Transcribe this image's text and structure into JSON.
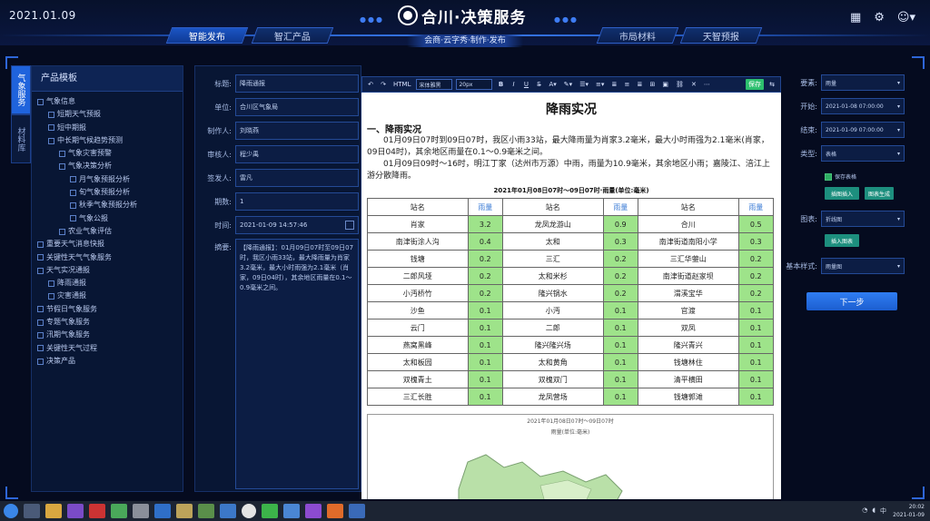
{
  "header": {
    "date": "2021.01.09",
    "title": "合川·决策服务",
    "icons": [
      "grid-icon",
      "gear-icon",
      "user-icon"
    ]
  },
  "nav": {
    "left_tabs": [
      "智能发布",
      "智汇产品"
    ],
    "right_tabs": [
      "市局材料",
      "天智预报"
    ],
    "center": "会商·云字秀·制作·发布"
  },
  "sidebar": {
    "side_tabs": [
      "气象服务",
      "材料库"
    ],
    "title": "产品模板",
    "items": [
      {
        "label": "气象信息",
        "level": 1
      },
      {
        "label": "短期天气预报",
        "level": 2
      },
      {
        "label": "短中期报",
        "level": 2
      },
      {
        "label": "中长期气候趋势预测",
        "level": 2
      },
      {
        "label": "气象灾害预警",
        "level": 3
      },
      {
        "label": "气象决策分析",
        "level": 3
      },
      {
        "label": "月气象预报分析",
        "level": 4
      },
      {
        "label": "旬气象预报分析",
        "level": 4
      },
      {
        "label": "秋季气象预报分析",
        "level": 4
      },
      {
        "label": "气象公报",
        "level": 4
      },
      {
        "label": "农业气象评估",
        "level": 3
      },
      {
        "label": "重要天气消息快报",
        "level": 1
      },
      {
        "label": "关键性天气气象服务",
        "level": 1
      },
      {
        "label": "天气实况通报",
        "level": 1
      },
      {
        "label": "降雨通报",
        "level": 2
      },
      {
        "label": "灾害通报",
        "level": 2
      },
      {
        "label": "节假日气象服务",
        "level": 1
      },
      {
        "label": "专题气象服务",
        "level": 1
      },
      {
        "label": "汛期气象服务",
        "level": 1
      },
      {
        "label": "关键性天气过程",
        "level": 1
      },
      {
        "label": "决策产品",
        "level": 1
      }
    ]
  },
  "form": {
    "fields": [
      {
        "label": "标题:",
        "value": "降雨通报"
      },
      {
        "label": "单位:",
        "value": "合川区气象局"
      },
      {
        "label": "制作人:",
        "value": "刘晓燕"
      },
      {
        "label": "审核人:",
        "value": "程少禹"
      },
      {
        "label": "签发人:",
        "value": "雷凡"
      },
      {
        "label": "期数:",
        "value": "1"
      },
      {
        "label": "时间:",
        "value": "2021-01-09 14:57:46"
      }
    ],
    "summary_label": "摘要:",
    "summary": "【降雨通报】：01月09日07时至09日07时，我区小雨33站，最大降雨量为肖家3.2毫米，最大小时雨强为2.1毫米（肖家，09日04时），其余地区雨量在0.1～0.9毫米之间。"
  },
  "editor": {
    "toolbar": {
      "html": "HTML",
      "font": "宋体雅黑",
      "size": "20px",
      "bold": "B",
      "italic": "I",
      "underline": "U",
      "save": "保存",
      "swap": "⇆"
    },
    "doc_title": "降雨实况",
    "section": "一、降雨实况",
    "para1": "01月09日07时到09日07时，我区小雨33站，最大降雨量为肖家3.2毫米，最大小时雨强为2.1毫米(肖家，09日04时)，其余地区雨量在0.1～0.9毫米之间。",
    "para2": "01月09日09时～16时，明江丁家（达州市万源）中雨，雨量为10.9毫米，其余地区小雨；嘉陵江、涪江上游分散降雨。",
    "table_title": "2021年01月08日07时～09日07时·雨量(单位:毫米)",
    "table_headers": [
      "站名",
      "雨量",
      "站名",
      "雨量",
      "站名",
      "雨量"
    ],
    "rows": [
      [
        "肖家",
        "3.2",
        "龙凤龙游山",
        "0.9",
        "合川",
        "0.5"
      ],
      [
        "南津街涂人沟",
        "0.4",
        "太和",
        "0.3",
        "南津街道南阳小学",
        "0.3"
      ],
      [
        "钱塘",
        "0.2",
        "三汇",
        "0.2",
        "三汇华蓥山",
        "0.2"
      ],
      [
        "二郎风垭",
        "0.2",
        "太和米杉",
        "0.2",
        "南津街道赵家坝",
        "0.2"
      ],
      [
        "小沔桥竹",
        "0.2",
        "隆兴锅水",
        "0.2",
        "渭溪宝华",
        "0.2"
      ],
      [
        "沙鱼",
        "0.1",
        "小沔",
        "0.1",
        "官渡",
        "0.1"
      ],
      [
        "云门",
        "0.1",
        "二郎",
        "0.1",
        "双凤",
        "0.1"
      ],
      [
        "燕窝黑峰",
        "0.1",
        "隆兴隆兴场",
        "0.1",
        "隆兴青兴",
        "0.1"
      ],
      [
        "太和板园",
        "0.1",
        "太和黄角",
        "0.1",
        "钱塘林住",
        "0.1"
      ],
      [
        "双槐青土",
        "0.1",
        "双槐双门",
        "0.1",
        "清平横田",
        "0.1"
      ],
      [
        "三汇长胜",
        "0.1",
        "龙凤营场",
        "0.1",
        "钱塘郭滩",
        "0.1"
      ]
    ],
    "map_caption_1": "2021年01月08日07时～09日07时",
    "map_caption_2": "雨量(单位:毫米)"
  },
  "right": {
    "fields": [
      {
        "label": "要素:",
        "value": "雨量"
      },
      {
        "label": "开始:",
        "value": "2021-01-08 07:00:00"
      },
      {
        "label": "结束:",
        "value": "2021-01-09 07:00:00"
      },
      {
        "label": "类型:",
        "value": "表格"
      }
    ],
    "checkbox": "保存表格",
    "btn_insert_table": "插图插入",
    "btn_preview": "图表生成",
    "chart_label": "图表:",
    "chart_value": "折线图",
    "btn_insert_chart": "插入图表",
    "style_label": "基本样式:",
    "style_value": "雨量图",
    "next": "下一步"
  },
  "taskbar": {
    "time": "20:02",
    "date": "2021-01-09"
  },
  "colors": {
    "accent": "#1f63dc",
    "cell_green": "#9ee38a",
    "bg": "#050b1f"
  }
}
